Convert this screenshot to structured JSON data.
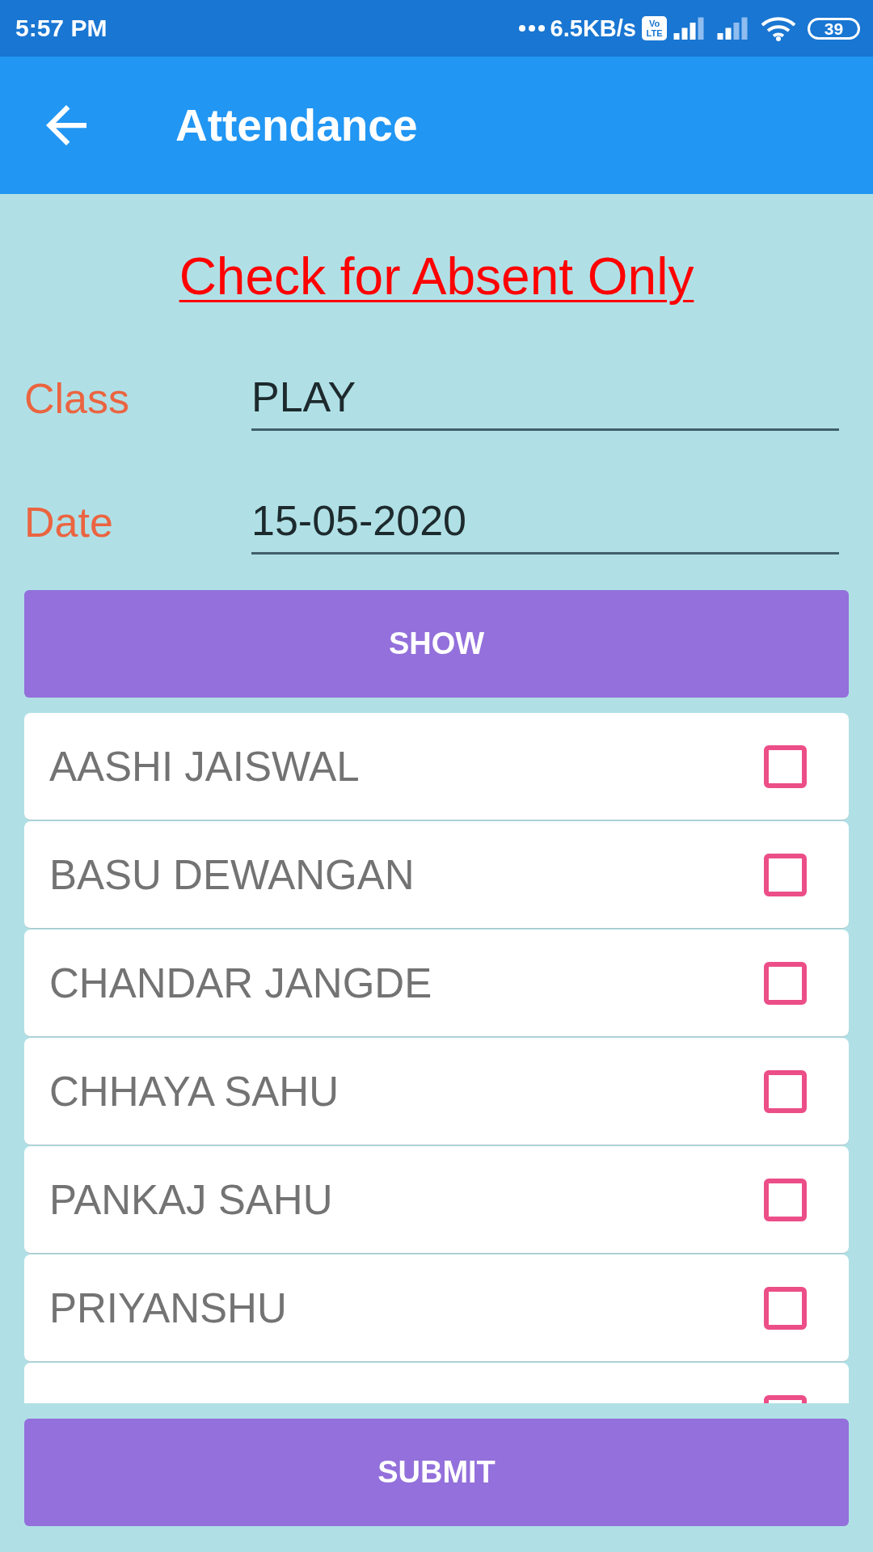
{
  "status_bar": {
    "time": "5:57 PM",
    "network_speed": "6.5KB/s",
    "volte": "Vo LTE",
    "battery": "39"
  },
  "app_bar": {
    "title": "Attendance"
  },
  "instruction": "Check for Absent Only",
  "fields": [
    {
      "label": "Class",
      "value": "PLAY"
    },
    {
      "label": "Date",
      "value": "15-05-2020"
    }
  ],
  "show_button": "SHOW",
  "students": [
    {
      "name": "AASHI JAISWAL",
      "checked": false
    },
    {
      "name": "BASU DEWANGAN",
      "checked": false
    },
    {
      "name": "CHANDAR JANGDE",
      "checked": false
    },
    {
      "name": "CHHAYA SAHU",
      "checked": false
    },
    {
      "name": "PANKAJ SAHU",
      "checked": false
    },
    {
      "name": "PRIYANSHU",
      "checked": false
    },
    {
      "checked": false
    }
  ],
  "submit_button": "SUBMIT"
}
